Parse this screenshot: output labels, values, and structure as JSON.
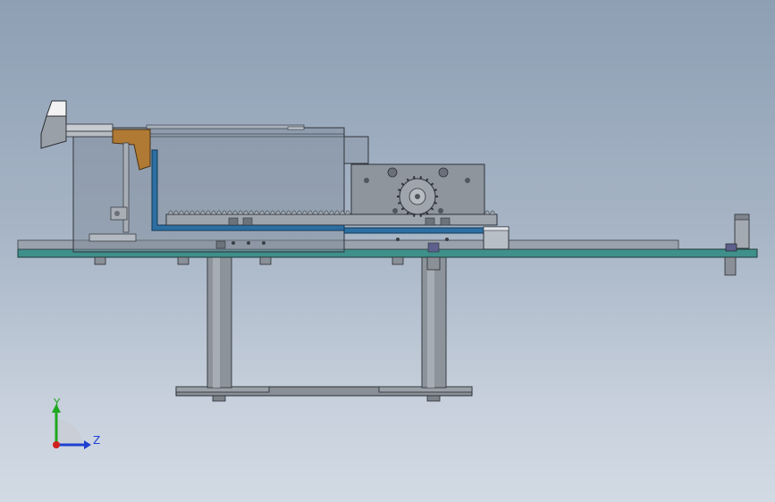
{
  "viewport": {
    "background_top": "#8e9fb4",
    "background_bottom": "#d2dae4"
  },
  "triad": {
    "y_label": "Y",
    "z_label": "Z",
    "y_color": "#1fa81f",
    "z_color": "#1f3fd0",
    "x_color": "#d01f1f"
  },
  "model": {
    "plate_color": "#3f8f8a",
    "frame_color": "#9aa3ad",
    "housing_color": "#7f8a99",
    "bracket_color": "#b07a35",
    "channel_color": "#2c6fa3"
  }
}
